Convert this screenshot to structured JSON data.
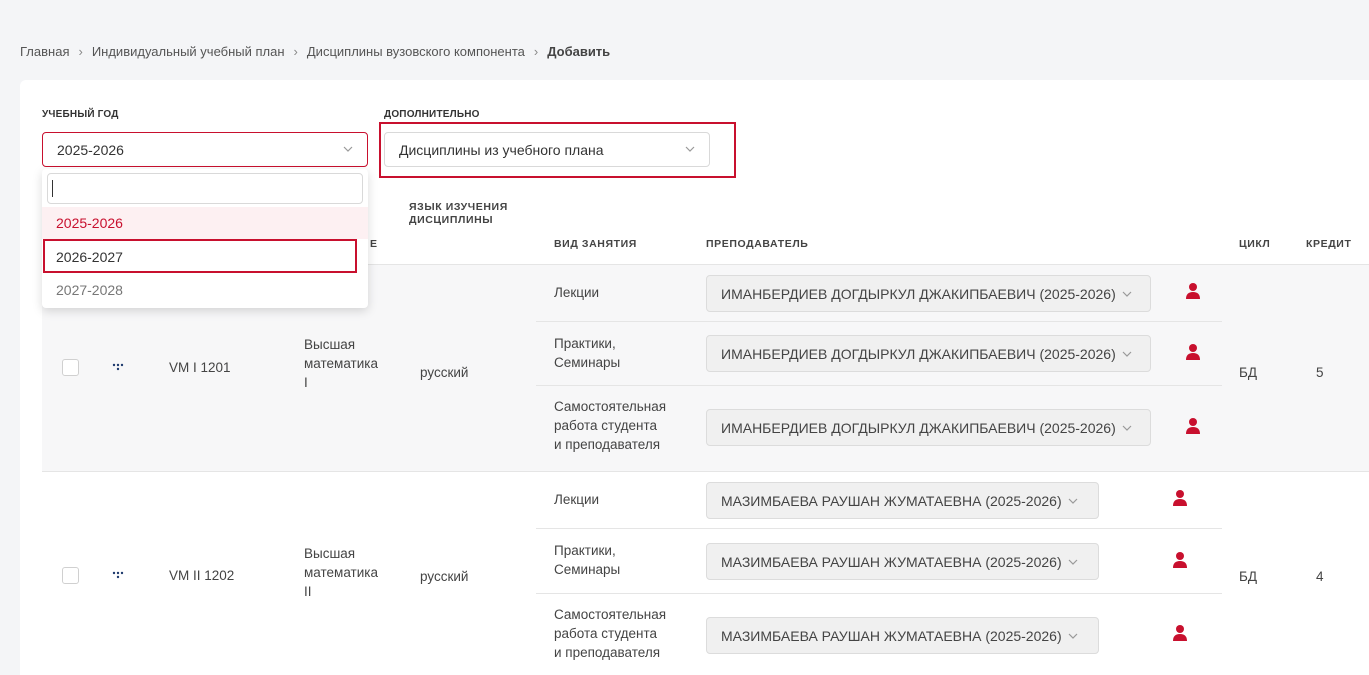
{
  "breadcrumb": {
    "items": [
      "Главная",
      "Индивидуальный учебный план",
      "Дисциплины вузовского компонента"
    ],
    "current": "Добавить",
    "separator": "›"
  },
  "filters": {
    "year_label": "УЧЕБНЫЙ ГОД",
    "year_value": "2025-2026",
    "extra_label": "ДОПОЛНИТЕЛЬНО",
    "extra_value": "Дисциплины из учебного плана"
  },
  "dropdown": {
    "search_value": "",
    "options": [
      "2025-2026",
      "2026-2027",
      "2027-2028"
    ]
  },
  "table": {
    "headers": {
      "language": "ЯЗЫК ИЗУЧЕНИЯ ДИСЦИПЛИНЫ",
      "lesson_type": "ВИД ЗАНЯТИЯ",
      "teacher": "ПРЕПОДАВАТЕЛЬ",
      "cycle": "ЦИКЛ",
      "credits": "КРЕДИТ",
      "partial_hidden": "Е"
    },
    "rows": [
      {
        "code": "VM I 1201",
        "name_lines": [
          "Высшая",
          "математика",
          "I"
        ],
        "language": "русский",
        "cycle": "БД",
        "credits": "5",
        "lessons": [
          {
            "type_lines": [
              "Лекции"
            ],
            "teacher": "ИМАНБЕРДИЕВ ДОГДЫРКУЛ ДЖАКИПБАЕВИЧ (2025-2026)"
          },
          {
            "type_lines": [
              "Практики,",
              "Семинары"
            ],
            "teacher": "ИМАНБЕРДИЕВ ДОГДЫРКУЛ ДЖАКИПБАЕВИЧ (2025-2026)"
          },
          {
            "type_lines": [
              "Самостоятельная",
              "работа студента",
              "и преподавателя"
            ],
            "teacher": "ИМАНБЕРДИЕВ ДОГДЫРКУЛ ДЖАКИПБАЕВИЧ (2025-2026)"
          }
        ]
      },
      {
        "code": "VM II 1202",
        "name_lines": [
          "Высшая",
          "математика",
          "II"
        ],
        "language": "русский",
        "cycle": "БД",
        "credits": "4",
        "lessons": [
          {
            "type_lines": [
              "Лекции"
            ],
            "teacher": "МАЗИМБАЕВА РАУШАН ЖУМАТАЕВНА (2025-2026)"
          },
          {
            "type_lines": [
              "Практики,",
              "Семинары"
            ],
            "teacher": "МАЗИМБАЕВА РАУШАН ЖУМАТАЕВНА (2025-2026)"
          },
          {
            "type_lines": [
              "Самостоятельная",
              "работа студента",
              "и преподавателя"
            ],
            "teacher": "МАЗИМБАЕВА РАУШАН ЖУМАТАЕВНА (2025-2026)"
          }
        ]
      }
    ]
  },
  "colors": {
    "accent_red": "#c8102e",
    "selected_option_bg": "#fdf0f2",
    "row_alt_bg": "#f7f7f8",
    "person_icon": "#c8102e"
  },
  "icons": {
    "chevron": "chevron-down-icon",
    "person": "person-icon",
    "drag": "drag-dots-icon"
  }
}
